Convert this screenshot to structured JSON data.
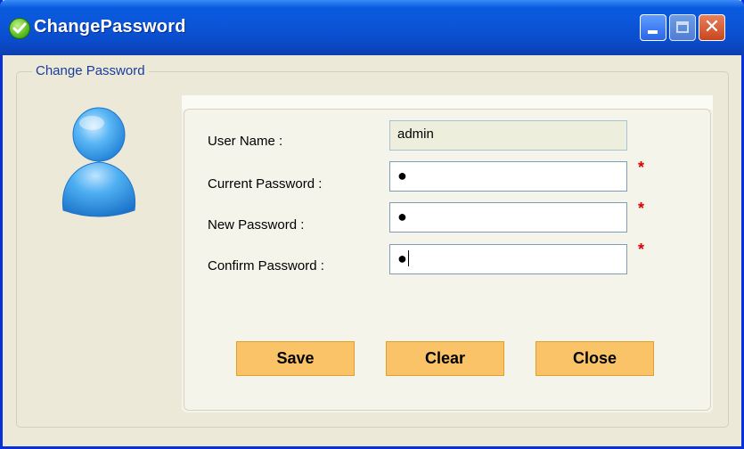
{
  "window": {
    "title": "ChangePassword"
  },
  "group": {
    "label": "Change Password"
  },
  "form": {
    "username_label": "User Name :",
    "username_value": "admin",
    "current_password_label": "Current Password :",
    "new_password_label": "New Password :",
    "confirm_password_label": "Confirm Password :",
    "password_mask": "●",
    "required_marker": "*"
  },
  "buttons": {
    "save": "Save",
    "clear": "Clear",
    "close": "Close"
  },
  "colors": {
    "title_bar": "#0A55D8",
    "button_fill": "#FAC368",
    "required": "#E00000",
    "label_blue": "#1A3C9C"
  }
}
